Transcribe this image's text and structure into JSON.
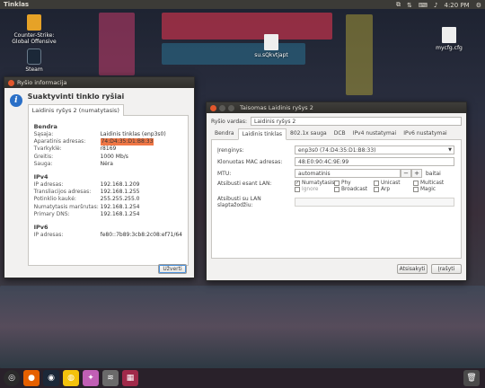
{
  "topbar": {
    "title": "Tinklas",
    "time": "4:20 PM"
  },
  "desktop": {
    "icons": [
      {
        "label": "Counter-Strike: Global Offensive"
      },
      {
        "label": "Steam"
      },
      {
        "label": "su.sQkvtjapt"
      },
      {
        "label": "mycfg.cfg"
      }
    ]
  },
  "info_dialog": {
    "title": "Ryšio informacija",
    "heading": "Suaktyvinti tinklo ryšiai",
    "tab_label": "Laidinis ryšys 2 (numatytasis)",
    "general": {
      "section": "Bendra",
      "rows": [
        {
          "k": "Sąsaja:",
          "v": "Laidinis tinklas (enp3s0)"
        },
        {
          "k": "Aparatinis adresas:",
          "v": "74:D4:35:D1:B8:33"
        },
        {
          "k": "Tvarkyklė:",
          "v": "r8169"
        },
        {
          "k": "Greitis:",
          "v": "1000 Mb/s"
        },
        {
          "k": "Sauga:",
          "v": "Nėra"
        }
      ]
    },
    "ipv4": {
      "section": "IPv4",
      "rows": [
        {
          "k": "IP adresas:",
          "v": "192.168.1.209"
        },
        {
          "k": "Transliacijos adresas:",
          "v": "192.168.1.255"
        },
        {
          "k": "Potinklio kaukė:",
          "v": "255.255.255.0"
        },
        {
          "k": "Numatytasis maršrutas:",
          "v": "192.168.1.254"
        },
        {
          "k": "Primary DNS:",
          "v": "192.168.1.254"
        }
      ]
    },
    "ipv6": {
      "section": "IPv6",
      "rows": [
        {
          "k": "IP adresas:",
          "v": "fe80::7b89:3cb8:2c08:ef71/64"
        }
      ]
    },
    "close_label": "Užverti"
  },
  "edit_dialog": {
    "title": "Taisomas Laidinis ryšys 2",
    "name_label": "Ryšio vardas:",
    "name_value": "Laidinis ryšys 2",
    "tabs": [
      "Bendra",
      "Laidinis tinklas",
      "802.1x sauga",
      "DCB",
      "IPv4 nustatymai",
      "IPv6 nustatymai"
    ],
    "device_label": "Įrenginys:",
    "device_value": "enp3s0 (74:D4:35:D1:B8:33)",
    "mac_label": "Klonuotas MAC adresas:",
    "mac_value": "48:E0:90:4C:9E:99",
    "mtu_label": "MTU:",
    "mtu_value": "automatinis",
    "mtu_unit": "baitai",
    "wake_label": "Atsibusti esant LAN:",
    "wake_options": [
      {
        "label": "Numatytasis",
        "checked": true,
        "dim": false
      },
      {
        "label": "Phy",
        "checked": false,
        "dim": false
      },
      {
        "label": "Unicast",
        "checked": false,
        "dim": false
      },
      {
        "label": "Multicast",
        "checked": false,
        "dim": false
      },
      {
        "label": "Ignore",
        "checked": false,
        "dim": true
      },
      {
        "label": "Broadcast",
        "checked": false,
        "dim": false
      },
      {
        "label": "Arp",
        "checked": false,
        "dim": false
      },
      {
        "label": "Magic",
        "checked": false,
        "dim": false
      }
    ],
    "wake_password_label": "Atsibusti su LAN slaptažodžiu:",
    "cancel_label": "Atsisakyti",
    "save_label": "Įrašyti"
  }
}
